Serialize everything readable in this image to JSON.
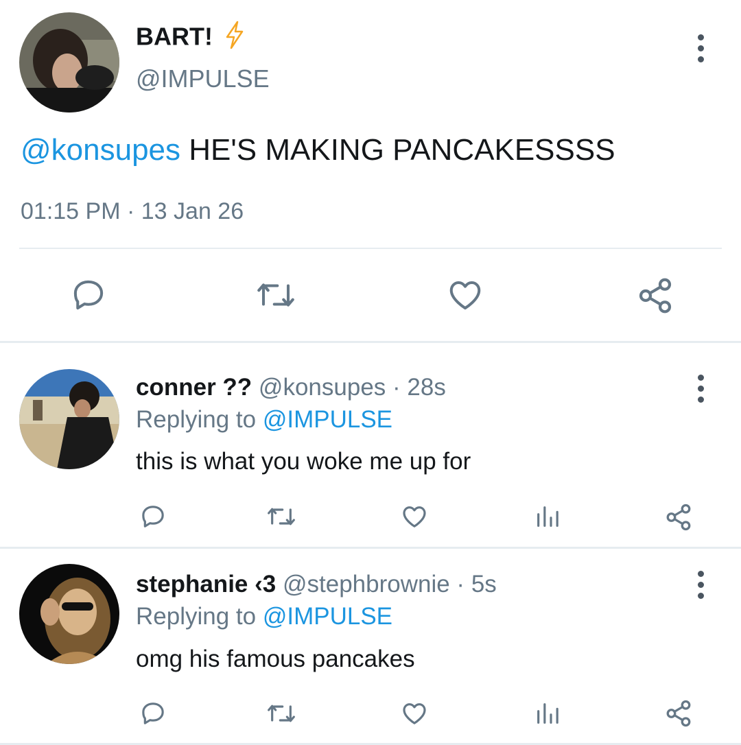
{
  "main_tweet": {
    "display_name": "BART!",
    "name_emoji": "⚡",
    "handle": "@IMPULSE",
    "mention": "@konsupes",
    "text": " HE'S MAKING PANCAKESSSS",
    "time": "01:15 PM",
    "separator": "·",
    "date": "13 Jan 26"
  },
  "replies": [
    {
      "display_name": "conner ??",
      "handle": "@konsupes",
      "age": "28s",
      "replying_prefix": "Replying to ",
      "replying_to": "@IMPULSE",
      "text": "this is what you woke me up for"
    },
    {
      "display_name": "stephanie ‹3",
      "handle": "@stephbrownie",
      "age": "5s",
      "replying_prefix": "Replying to ",
      "replying_to": "@IMPULSE",
      "text": "omg his famous pancakes"
    }
  ],
  "colors": {
    "link": "#1b95e0",
    "muted": "#657786",
    "icon": "#657786",
    "divider": "#e6ecf0",
    "lightning": "#f5a623"
  },
  "icons": [
    "reply-icon",
    "retweet-icon",
    "like-icon",
    "share-icon",
    "analytics-icon",
    "more-icon",
    "lightning-icon"
  ]
}
